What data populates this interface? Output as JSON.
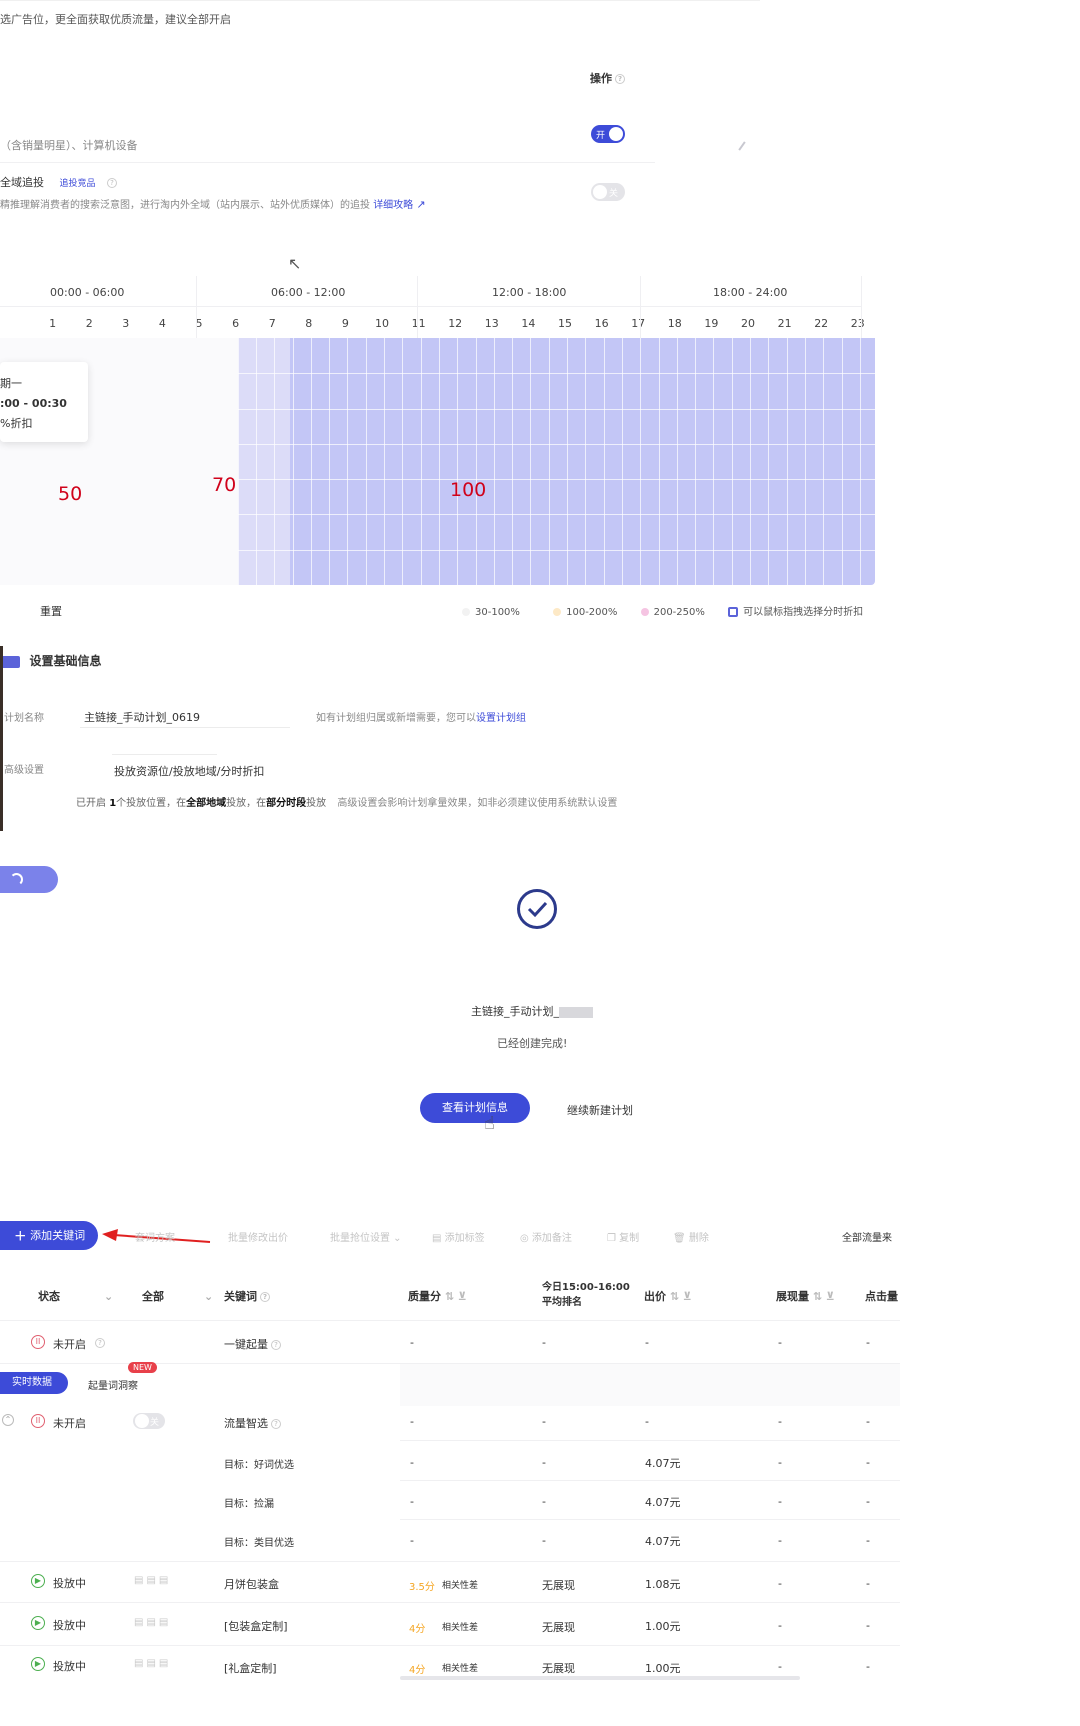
{
  "top_notice": "选广告位，更全面获取优质流量，建议全部开启",
  "operation_col": {
    "label": "操作"
  },
  "device_row": {
    "text": "（含销量明星）、计算机设备",
    "toggle": "开"
  },
  "global_row": {
    "title": "全域追投",
    "tag": "追投竞品",
    "desc": "精推理解消费者的搜索泛意图，进行淘内外全域（站内展示、站外优质媒体）的追投",
    "guide": "详细攻略",
    "toggle": "关"
  },
  "time_grid": {
    "headers": [
      "00:00 - 06:00",
      "06:00 - 12:00",
      "12:00 - 18:00",
      "18:00 - 24:00"
    ],
    "hours": [
      "1",
      "2",
      "3",
      "4",
      "5",
      "6",
      "7",
      "8",
      "9",
      "10",
      "11",
      "12",
      "13",
      "14",
      "15",
      "16",
      "17",
      "18",
      "19",
      "20",
      "21",
      "22",
      "23"
    ],
    "zones": [
      {
        "label": "50",
        "from_hour": 0,
        "to_hour": 6,
        "color": "#fafafc"
      },
      {
        "label": "70",
        "from_hour": 6,
        "to_hour": 8,
        "color": "#dcdcf8"
      },
      {
        "label": "100",
        "from_hour": 8,
        "to_hour": 24,
        "color": "#c3c6f6"
      }
    ],
    "tooltip": {
      "line1": "期一",
      "line2": ":00 - 00:30",
      "line3": "%折扣"
    },
    "reset": "重置",
    "legend": [
      {
        "label": "30-100%",
        "color": "#f2f2f2"
      },
      {
        "label": "100-200%",
        "color": "#fde9c6"
      },
      {
        "label": "200-250%",
        "color": "#f5c4e2"
      },
      {
        "label": "可以鼠标指拽选择分时折扣",
        "color": "#5b63d9"
      }
    ]
  },
  "basic_info": {
    "section_title": "设置基础信息",
    "plan_name_label": "计划名称",
    "plan_name_value": "主链接_手动计划_0619",
    "plan_group_hint": "如有计划组归属或新增需要，您可以",
    "plan_group_link": "设置计划组",
    "advanced_label": "高级设置",
    "advanced_value": "投放资源位/投放地域/分时折扣",
    "advanced_desc_1": "已开启",
    "advanced_desc_count": "1",
    "advanced_desc_2": "个投放位置，在",
    "advanced_desc_region": "全部地域",
    "advanced_desc_3": "投放，在",
    "advanced_desc_time": "部分时段",
    "advanced_desc_4": "投放",
    "advanced_desc_5": "高级设置会影响计划拿量效果，如非必须建议使用系统默认设置"
  },
  "success": {
    "plan_name": "主链接_手动计划_",
    "message": "已经创建完成!",
    "primary_button": "查看计划信息",
    "secondary_button": "继续新建计划"
  },
  "toolbar": {
    "add_keyword": "添加关键词",
    "items": [
      "批量修改出价",
      "批量抢位设置",
      "添加标签",
      "添加备注",
      "复制",
      "删除"
    ],
    "match_plan": "套词方案",
    "traffic": "全部流量来"
  },
  "table": {
    "headers": {
      "status": "状态",
      "all": "全部",
      "keyword": "关键词",
      "quality": "质量分",
      "rank_line1": "今日15:00-16:00",
      "rank_line2": "平均排名",
      "bid": "出价",
      "impressions": "展现量",
      "clicks": "点击量"
    },
    "one_click_row": {
      "status": "未开启",
      "keyword": "一键起量",
      "quality": "-",
      "rank": "-",
      "bid": "-",
      "impressions": "-",
      "clicks": "-"
    },
    "tabs": {
      "realtime": "实时数据",
      "insight": "起量词洞察",
      "new_badge": "NEW"
    },
    "smart_row": {
      "status": "未开启",
      "toggle": "关",
      "keyword": "流量智选",
      "quality": "-",
      "rank": "-",
      "bid": "-",
      "impressions": "-",
      "clicks": "-"
    },
    "target_rows": [
      {
        "keyword": "目标：好词优选",
        "quality": "-",
        "rank": "-",
        "bid": "4.07元",
        "impressions": "-",
        "clicks": "-"
      },
      {
        "keyword": "目标：捡漏",
        "quality": "-",
        "rank": "-",
        "bid": "4.07元",
        "impressions": "-",
        "clicks": "-"
      },
      {
        "keyword": "目标：类目优选",
        "quality": "-",
        "rank": "-",
        "bid": "4.07元",
        "impressions": "-",
        "clicks": "-"
      }
    ],
    "keyword_rows": [
      {
        "status": "投放中",
        "keyword": "月饼包装盒",
        "score": "3.5分",
        "relevance": "相关性差",
        "rank": "无展现",
        "bid": "1.08元",
        "impressions": "-",
        "clicks": "-"
      },
      {
        "status": "投放中",
        "keyword": "[包装盒定制]",
        "score": "4分",
        "relevance": "相关性差",
        "rank": "无展现",
        "bid": "1.00元",
        "impressions": "-",
        "clicks": "-"
      },
      {
        "status": "投放中",
        "keyword": "[礼盒定制]",
        "score": "4分",
        "relevance": "相关性差",
        "rank": "无展现",
        "bid": "1.00元",
        "impressions": "-",
        "clicks": "-"
      }
    ]
  }
}
